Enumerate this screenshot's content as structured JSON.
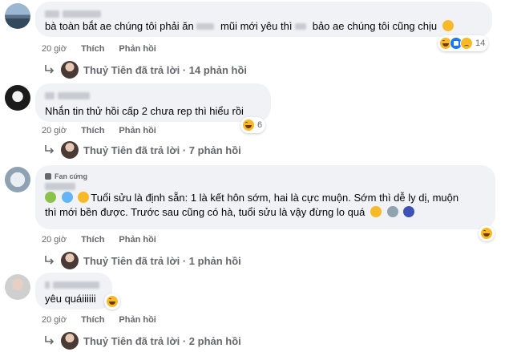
{
  "colors": {
    "bubble": "#f0f2f5",
    "meta": "#65676b",
    "text": "#050505",
    "haha": "#f7b928",
    "like": "#1877f2"
  },
  "reply_author": "Thuỷ Tiên",
  "comments": [
    {
      "text": "bà toàn bắt ae chúng tôi phải ăn",
      "text_mid": "mũi mới yêu thì",
      "text_end": "bảo ae chúng tôi cũng chịu",
      "time": "20 giờ",
      "like": "Thích",
      "reply": "Phản hồi",
      "reaction_count": "14",
      "reaction_icons": [
        "haha-icon",
        "like-icon",
        "sad-icon"
      ],
      "replies_text": "Thuỷ Tiên đã trả lời · 14 phản hồi"
    },
    {
      "text": "Nhắn tin thử hồi cấp 2 chưa rep thì hiểu rồi",
      "time": "20 giờ",
      "like": "Thích",
      "reply": "Phản hồi",
      "reaction_count": "6",
      "reaction_icons": [
        "haha-icon"
      ],
      "replies_text": "Thuỷ Tiên đã trả lời · 7 phản hồi"
    },
    {
      "badge": "Fan cứng",
      "line1": "Tuổi sửu là định sẵn: 1 là kết hôn sớm, hai là cực muộn. Sớm thì dễ ly dị, muộn",
      "line2": "thì mới bền được. Trước sau cũng có hà, tuổi sửu là vậy đừng lo quá",
      "time": "20 giờ",
      "like": "Thích",
      "reply": "Phản hồi",
      "reaction_icons": [
        "haha-icon"
      ],
      "replies_text": "Thuỷ Tiên đã trả lời · 1 phản hồi"
    },
    {
      "text": "yêu quáiiiiii",
      "time": "20 giờ",
      "like": "Thích",
      "reply": "Phản hồi",
      "reaction_icons": [
        "haha-icon"
      ],
      "replies_text": "Thuỷ Tiên đã trả lời · 2 phản hồi"
    }
  ]
}
